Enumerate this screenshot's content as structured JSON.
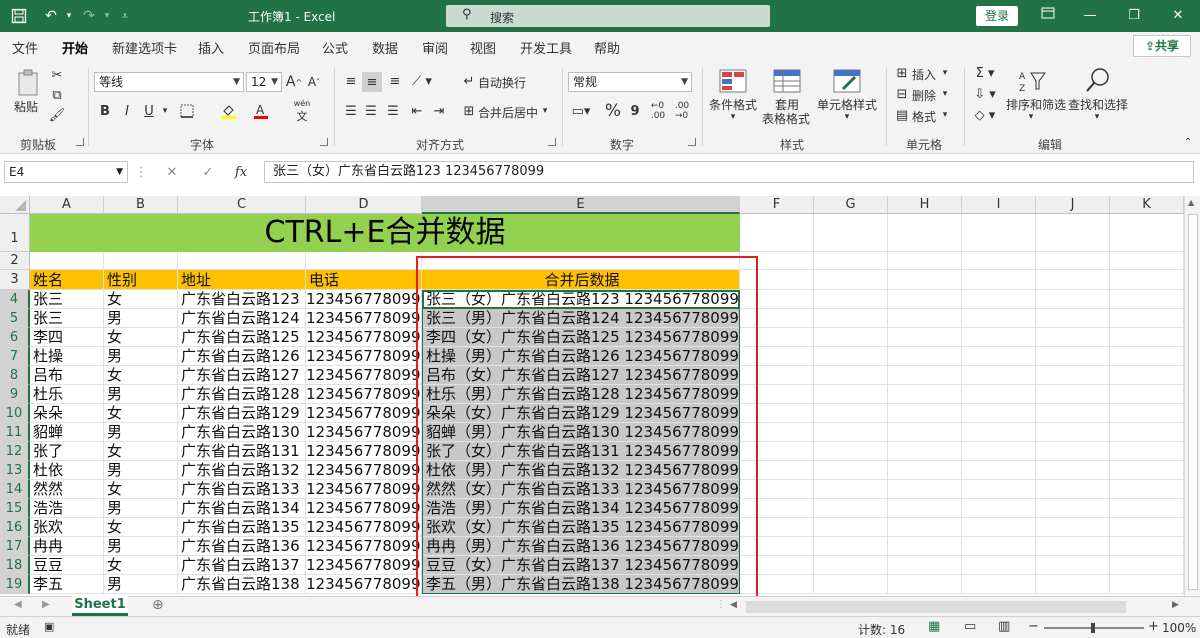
{
  "titlebar": {
    "title": "工作簿1  -  Excel",
    "search_placeholder": "搜索",
    "login_label": "登录"
  },
  "menu": {
    "tabs": [
      "文件",
      "开始",
      "新建选项卡",
      "插入",
      "页面布局",
      "公式",
      "数据",
      "审阅",
      "视图",
      "开发工具",
      "帮助"
    ],
    "active": "开始",
    "share_label": "共享"
  },
  "ribbon": {
    "clipboard": {
      "paste": "粘贴",
      "group": "剪贴板"
    },
    "font": {
      "name": "等线",
      "size": "12",
      "bold": "B",
      "italic": "I",
      "underline": "U",
      "group": "字体",
      "phonetic": "wén"
    },
    "alignment": {
      "wrap": "自动换行",
      "merge": "合并后居中",
      "group": "对齐方式"
    },
    "number": {
      "format": "常规",
      "percent": "%",
      "comma": "9",
      "group": "数字"
    },
    "styles": {
      "conditional": "条件格式",
      "table_line1": "套用",
      "table_line2": "表格格式",
      "cell_styles": "单元格样式",
      "group": "样式"
    },
    "cells": {
      "insert": "插入",
      "delete": "删除",
      "format": "格式",
      "group": "单元格"
    },
    "editing": {
      "sort": "排序和筛选",
      "find": "查找和选择",
      "group": "编辑"
    }
  },
  "formula_bar": {
    "name_box": "E4",
    "fx": "fx",
    "content": "张三（女）广东省白云路123 123456778099"
  },
  "grid": {
    "columns": [
      "A",
      "B",
      "C",
      "D",
      "E",
      "F",
      "G",
      "H",
      "I",
      "J",
      "K"
    ],
    "rows": [
      "1",
      "2",
      "3",
      "4",
      "5",
      "6",
      "7",
      "8",
      "9",
      "10",
      "11",
      "12",
      "13",
      "14",
      "15",
      "16",
      "17",
      "18",
      "19"
    ],
    "banner": "CTRL+E合并数据",
    "headers": [
      "姓名",
      "性别",
      "地址",
      "电话",
      "合并后数据"
    ],
    "data": [
      [
        "张三",
        "女",
        "广东省白云路123",
        "123456778099",
        "张三（女）广东省白云路123 123456778099"
      ],
      [
        "张三",
        "男",
        "广东省白云路124",
        "123456778099",
        "张三（男）广东省白云路124 123456778099"
      ],
      [
        "李四",
        "女",
        "广东省白云路125",
        "123456778099",
        "李四（女）广东省白云路125 123456778099"
      ],
      [
        "杜操",
        "男",
        "广东省白云路126",
        "123456778099",
        "杜操（男）广东省白云路126 123456778099"
      ],
      [
        "吕布",
        "女",
        "广东省白云路127",
        "123456778099",
        "吕布（女）广东省白云路127 123456778099"
      ],
      [
        "杜乐",
        "男",
        "广东省白云路128",
        "123456778099",
        "杜乐（男）广东省白云路128 123456778099"
      ],
      [
        "朵朵",
        "女",
        "广东省白云路129",
        "123456778099",
        "朵朵（女）广东省白云路129 123456778099"
      ],
      [
        "貂蝉",
        "男",
        "广东省白云路130",
        "123456778099",
        "貂蝉（男）广东省白云路130 123456778099"
      ],
      [
        "张了",
        "女",
        "广东省白云路131",
        "123456778099",
        "张了（女）广东省白云路131 123456778099"
      ],
      [
        "杜依",
        "男",
        "广东省白云路132",
        "123456778099",
        "杜依（男）广东省白云路132 123456778099"
      ],
      [
        "然然",
        "女",
        "广东省白云路133",
        "123456778099",
        "然然（女）广东省白云路133 123456778099"
      ],
      [
        "浩浩",
        "男",
        "广东省白云路134",
        "123456778099",
        "浩浩（男）广东省白云路134 123456778099"
      ],
      [
        "张欢",
        "女",
        "广东省白云路135",
        "123456778099",
        "张欢（女）广东省白云路135 123456778099"
      ],
      [
        "冉冉",
        "男",
        "广东省白云路136",
        "123456778099",
        "冉冉（男）广东省白云路136 123456778099"
      ],
      [
        "豆豆",
        "女",
        "广东省白云路137",
        "123456778099",
        "豆豆（女）广东省白云路137 123456778099"
      ],
      [
        "李五",
        "男",
        "广东省白云路138",
        "123456778099",
        "李五（男）广东省白云路138 123456778099"
      ]
    ]
  },
  "sheets": {
    "active": "Sheet1",
    "add": "⊕"
  },
  "status": {
    "ready": "就绪",
    "count": "计数: 16",
    "zoom": "100%"
  },
  "colors": {
    "brand": "#217346",
    "banner": "#92d050",
    "header": "#ffc000",
    "highlight_box": "#e02020"
  }
}
